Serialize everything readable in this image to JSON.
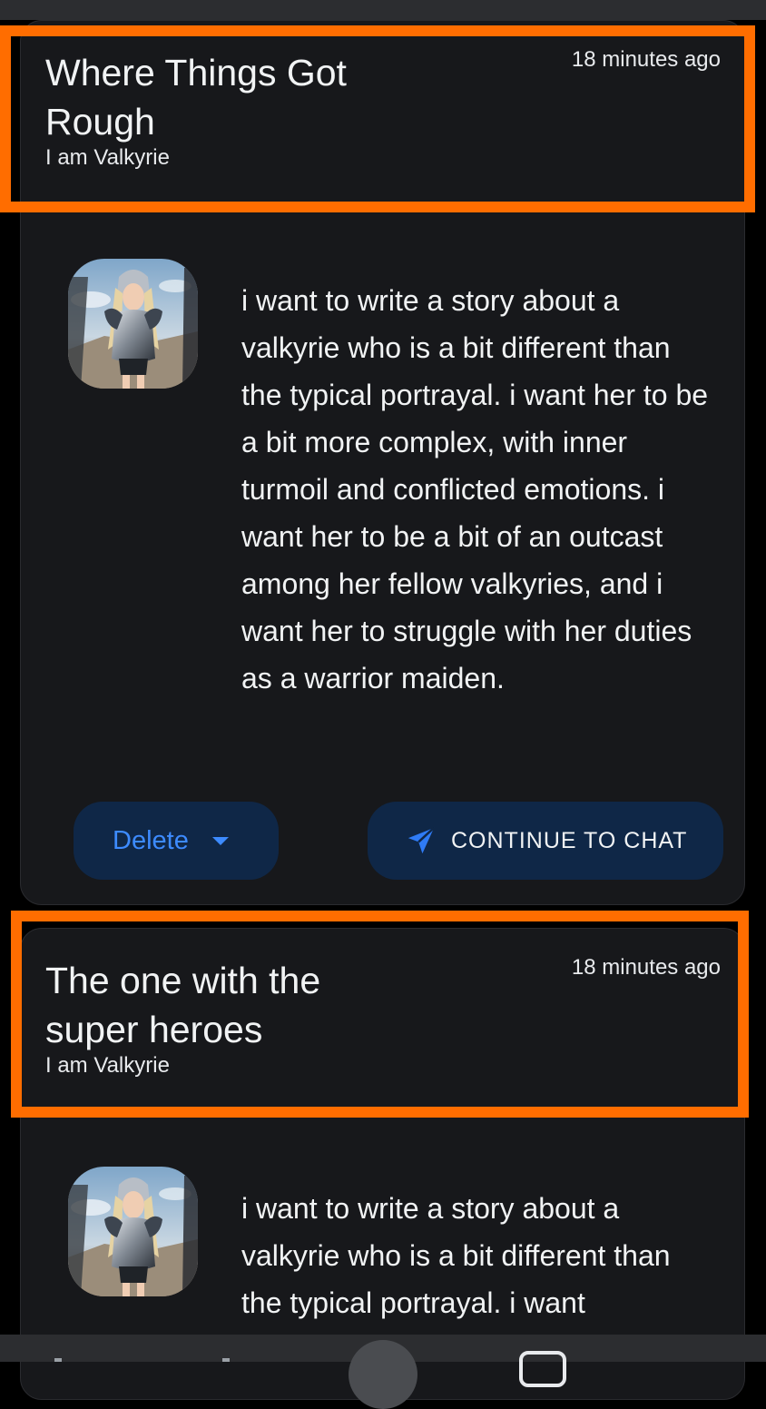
{
  "conversations": [
    {
      "title": "Where Things Got Rough",
      "character": "I am Valkyrie",
      "time": "18 minutes ago",
      "message": "i want to write a story about a valkyrie who is a bit different than the typical portrayal. i want her to be a bit more complex, with inner turmoil and conflicted emotions. i want her to be a bit of an outcast among her fellow valkyries, and i want her to struggle with her duties as a warrior maiden.",
      "delete_label": "Delete",
      "continue_label": "CONTINUE TO CHAT"
    },
    {
      "title": "The one with the super heroes",
      "character": "I am Valkyrie",
      "time": "18 minutes ago",
      "message": "i want to write a story about a valkyrie who is a bit different than the typical portrayal. i want"
    }
  ],
  "icons": {
    "send": "paper-plane-icon",
    "dropdown": "caret-down-icon",
    "avatar": "valkyrie-avatar"
  },
  "colors": {
    "card_bg": "#17181b",
    "button_bg": "#0f2747",
    "accent_blue": "#3d8bff",
    "highlight": "#ff6d00"
  }
}
